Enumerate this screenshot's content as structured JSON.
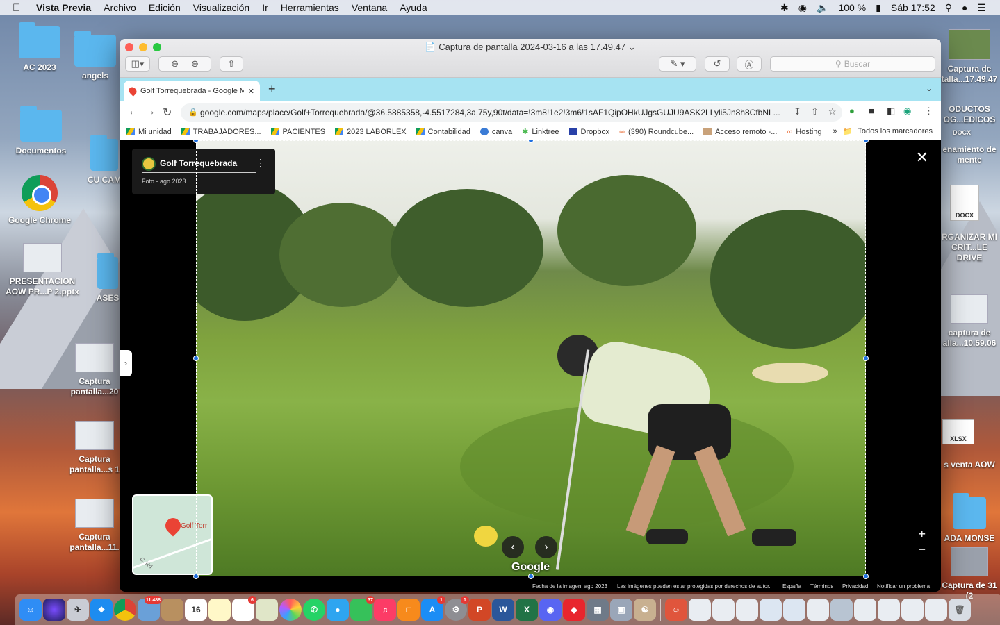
{
  "menubar": {
    "app_name": "Vista Previa",
    "items": [
      "Archivo",
      "Edición",
      "Visualización",
      "Ir",
      "Herramientas",
      "Ventana",
      "Ayuda"
    ],
    "battery": "100 %",
    "clock": "Sáb 17:52"
  },
  "desktop": {
    "icons_left": [
      {
        "label": "AC 2023",
        "type": "folder"
      },
      {
        "label": "Documentos",
        "type": "folder"
      },
      {
        "label": "Google Chrome",
        "type": "chrome"
      },
      {
        "label": "PRESENTACION AOW PR...P 2.pptx",
        "type": "thumb"
      }
    ],
    "icons_col2": [
      {
        "label": "angels"
      },
      {
        "label": "CU CAM"
      },
      {
        "label": "ASES"
      },
      {
        "label": "Captura pantalla...20"
      },
      {
        "label": "Captura pantalla...s 1"
      },
      {
        "label": "Captura pantalla...11."
      }
    ],
    "icons_right": [
      {
        "label": "Captura de talla...17.49.47"
      },
      {
        "label": "ODUCTOS OG...EDICOS"
      },
      {
        "label": "DOCX"
      },
      {
        "label": "enamiento de mente"
      },
      {
        "label": "DOCX"
      },
      {
        "label": "RGANIZAR MI CRIT...LE DRIVE"
      },
      {
        "label": "captura de alla...10.59.06"
      },
      {
        "label": "XLSX"
      },
      {
        "label": "s venta AOW"
      },
      {
        "label": "ADA MONSE"
      },
      {
        "label": "Captura de 31 (2"
      }
    ]
  },
  "preview": {
    "title": "Captura de pantalla 2024-03-16 a las 17.49.47",
    "search_placeholder": "Buscar"
  },
  "browser": {
    "tab_title": "Golf Torrequebrada - Google M",
    "url": "google.com/maps/place/Golf+Torrequebrada/@36.5885358,-4.5517284,3a,75y,90t/data=!3m8!1e2!3m6!1sAF1QipOHkUJgsGUJU9ASK2LLyli5Jn8h8CfbNL...",
    "bookmarks": [
      "Mi unidad",
      "TRABAJADORES...",
      "PACIENTES",
      "2023 LABORLEX",
      "Contabilidad",
      "canva",
      "Linktree",
      "Dropbox",
      "(390) Roundcube...",
      "Acceso remoto -...",
      "Hosting"
    ],
    "bookmarks_more": "»",
    "all_bookmarks": "Todos los marcadores"
  },
  "maps": {
    "place_name": "Golf Torrequebrada",
    "photo_meta": "Foto - ago 2023",
    "minimap_label": "Golf Torr",
    "minimap_road": "C. Rd",
    "watermark": "Google",
    "footer": {
      "date": "Fecha de la imagen: ago 2023",
      "copyright": "Las imágenes pueden estar protegidas por derechos de autor.",
      "country": "España",
      "terms": "Términos",
      "privacy": "Privacidad",
      "report": "Notificar un problema"
    }
  },
  "dock": {
    "badges": {
      "photos": "11.488",
      "calendar_day": "16",
      "reminders": "6",
      "facetime": "37",
      "appstore": "1",
      "settings": "1"
    }
  }
}
